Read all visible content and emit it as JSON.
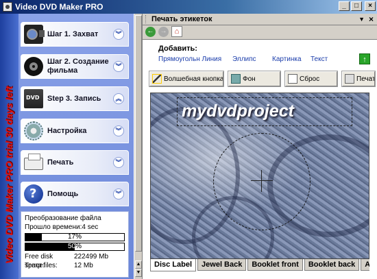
{
  "window": {
    "title": "Video DVD Maker PRO"
  },
  "trial_banner": "Video DVD Maker PRO trial 30 days left",
  "steps": [
    {
      "label": "Шаг 1. Захват",
      "icon": "camera-icon",
      "chevron": "down"
    },
    {
      "label": "Шаг 2. Создание фильма",
      "icon": "film-reel-icon",
      "chevron": "down"
    },
    {
      "label": "Step 3. Запись",
      "icon": "dvd-icon",
      "chevron": "up"
    },
    {
      "label": "Настройка",
      "icon": "gear-icon",
      "chevron": "down"
    },
    {
      "label": "Печать",
      "icon": "printer-icon",
      "chevron": "down"
    },
    {
      "label": "Помощь",
      "icon": "help-icon",
      "chevron": "down"
    }
  ],
  "status": {
    "converting": "Преобразование файла",
    "elapsed": "Прошло времени:4 sec",
    "progress1": {
      "value": 17,
      "label": "17%"
    },
    "progress2": {
      "value": 50,
      "label": "50%"
    },
    "free_disk_label": "Free disk space:",
    "free_disk_value": "222499 Mb",
    "temp_label": "Temp files:",
    "temp_value": "12 Mb"
  },
  "panel": {
    "title": "Печать этикеток",
    "add_label": "Добавить:",
    "add_links": [
      "Прямоугольн Линия",
      "Эллипс",
      "Картинка",
      "Текст"
    ],
    "toolbar": [
      "Волшебная кнопка",
      "Фон",
      "Сброс",
      "Печать"
    ],
    "canvas_text": "mydvdproject",
    "tabs": [
      "Disc Label",
      "Jewel Back",
      "Booklet front",
      "Booklet back",
      "Au"
    ],
    "active_tab": "Disc Label"
  },
  "colors": {
    "accent": "#0a246a",
    "trial_text": "#e01010",
    "link": "#1a3caa"
  }
}
